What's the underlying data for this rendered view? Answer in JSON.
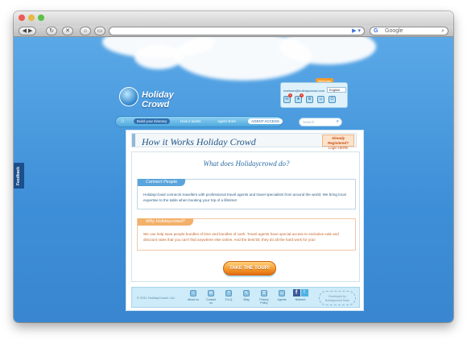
{
  "browser": {
    "search_placeholder": "Google",
    "address_text": ""
  },
  "feedback_tab": "Feedback",
  "logo": {
    "text": "Holiday Crowd"
  },
  "userbox": {
    "welcome": "Welcome",
    "email": "reviewer@holidaycrowd.com",
    "language": "English",
    "badges": [
      "1",
      "3"
    ]
  },
  "nav": {
    "items": [
      {
        "label": "Build your itinerary"
      },
      {
        "label": "How it works"
      },
      {
        "label": "Agent store"
      },
      {
        "label": "AGENT ACCESS"
      }
    ],
    "search_placeholder": "Search"
  },
  "page": {
    "title": "How it Works Holiday Crowd",
    "registered_line1": "Already Registered?",
    "registered_line2": "Login HERE"
  },
  "content": {
    "heading": "What does Holidaycrowd do?",
    "connect": {
      "label": "Connect People",
      "text": "Holidaycrowd connects travellers with professional travel agents and travel specialists from around the world. We bring local expertise to the table when booking your trip of a lifetime!"
    },
    "why": {
      "label": "Why Holidaycrowd?",
      "text": "We can help save people bundles of time and bundles of cash. Travel agents have special access to exclusive eals and discount rates that you can't find anywhere else online. And the best bit, they do all the hard work for you!"
    },
    "tour_button": "TAKE THE TOUR!"
  },
  "footer": {
    "copyright": "© 2011 HolidayCrowd. Ltd.",
    "items": [
      {
        "label": "About us",
        "icon": "about-icon"
      },
      {
        "label": "Contact us",
        "icon": "mail-icon"
      },
      {
        "label": "F.A.Q",
        "icon": "faq-icon"
      },
      {
        "label": "Blog",
        "icon": "blog-icon"
      },
      {
        "label": "Privacy Policy",
        "icon": "privacy-icon"
      },
      {
        "label": "Agents",
        "icon": "agents-icon"
      }
    ],
    "social_label": "Network",
    "stamp_line1": "Developed by",
    "stamp_line2": "Holidaycrowd Team"
  }
}
